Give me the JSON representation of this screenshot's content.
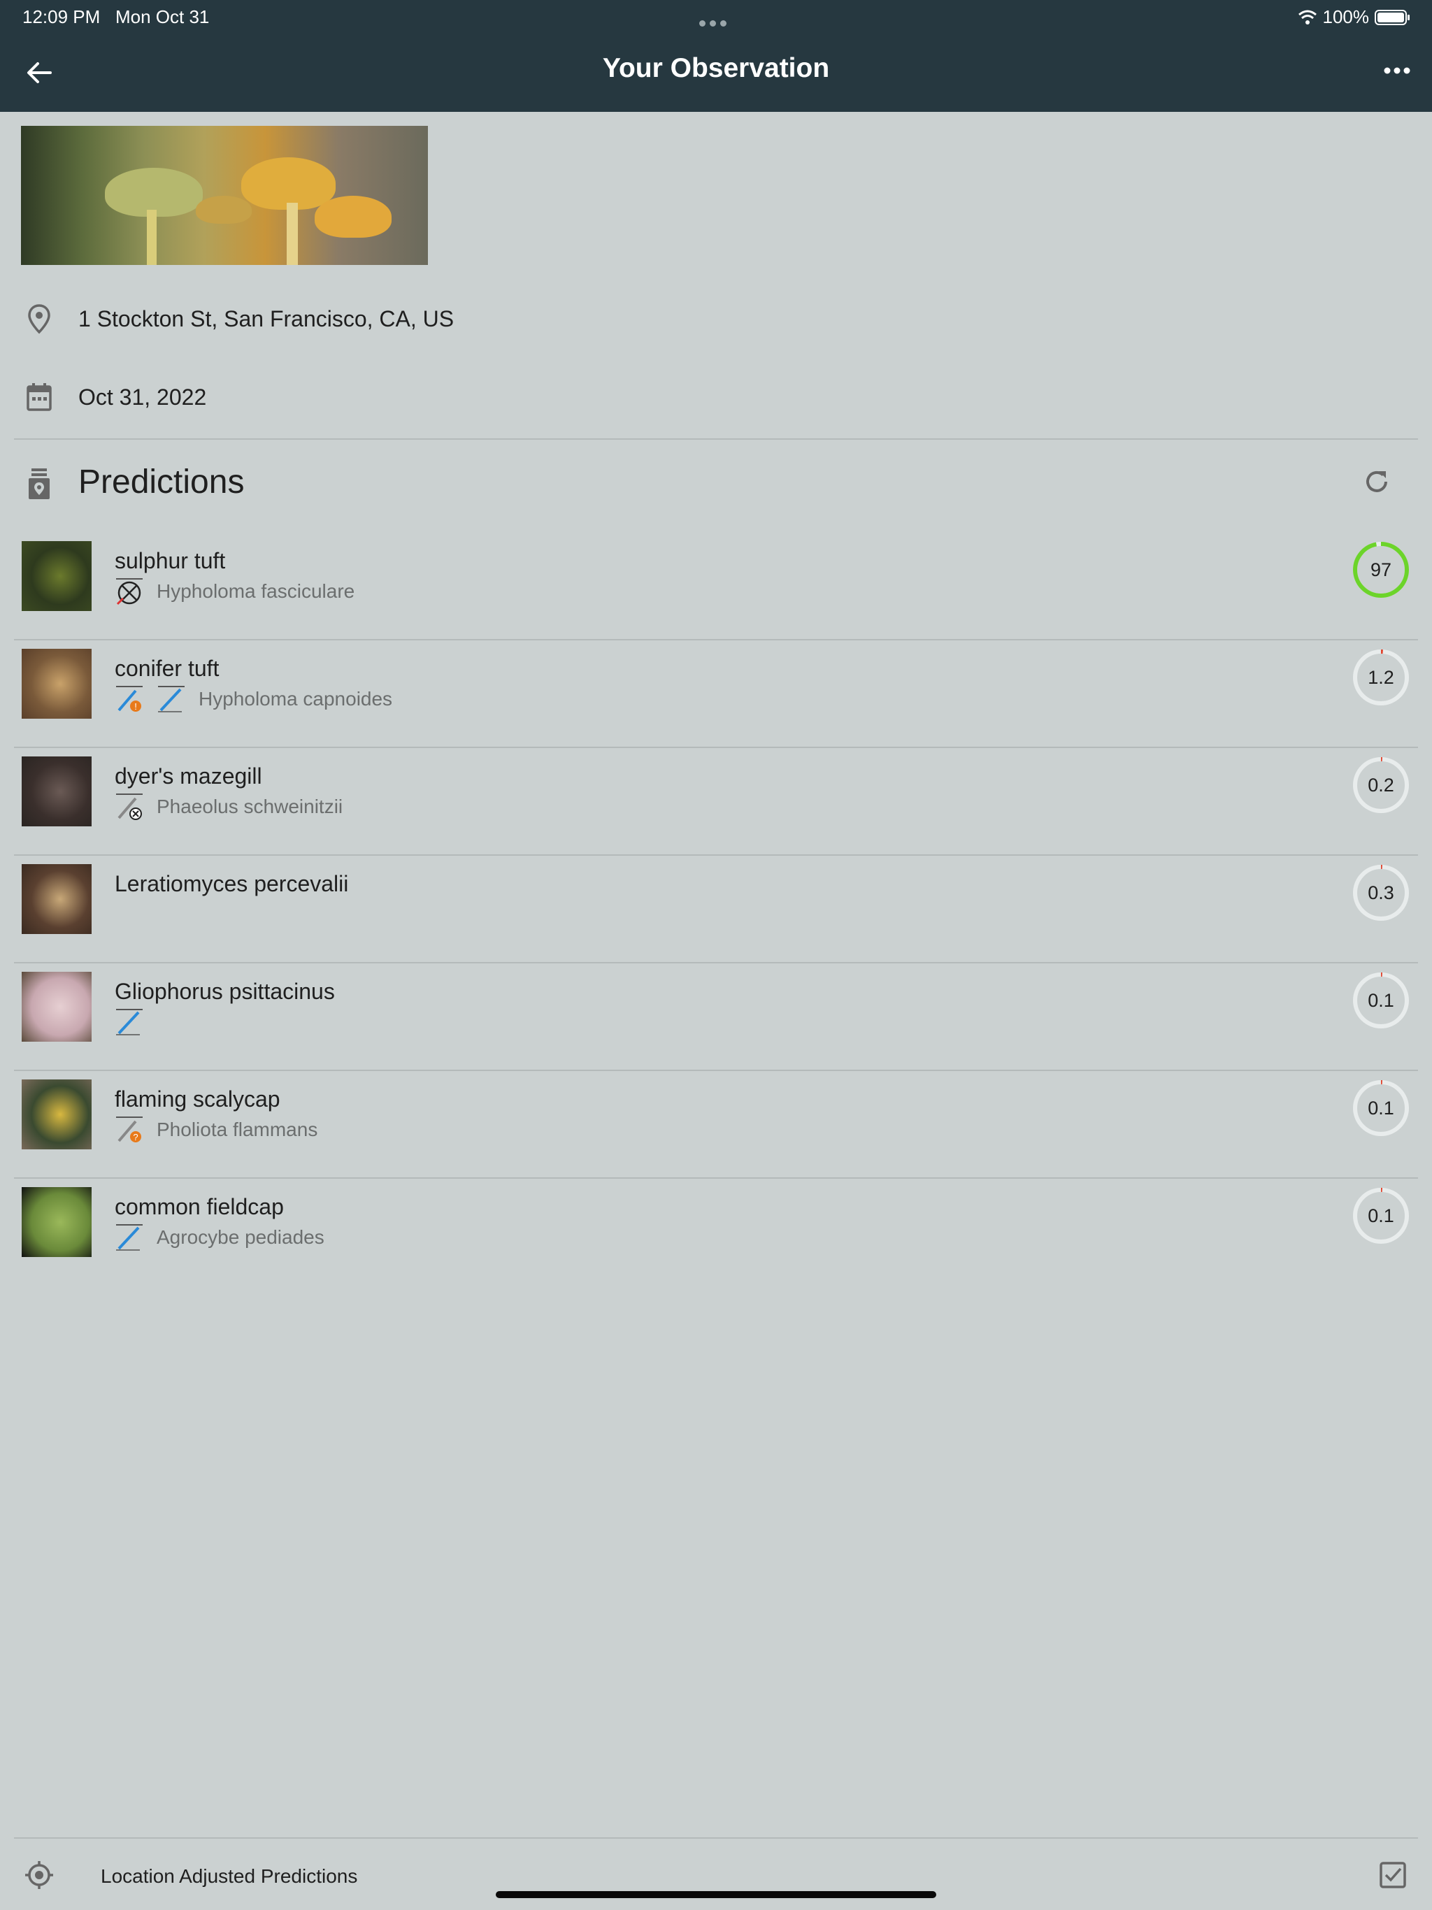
{
  "status_bar": {
    "time": "12:09 PM",
    "date": "Mon Oct 31",
    "battery": "100%"
  },
  "header": {
    "title": "Your Observation",
    "back_icon": "arrow-left-icon",
    "more_icon": "more-horizontal-icon",
    "background": "#263840"
  },
  "observation": {
    "location": "1 Stockton St, San Francisco, CA, US",
    "date": "Oct 31, 2022"
  },
  "predictions": {
    "title": "Predictions",
    "items": [
      {
        "name": "sulphur tuft",
        "scientific": "Hypholoma fasciculare",
        "badges": [
          "poison"
        ],
        "score": "97",
        "score_fraction": 0.97,
        "ring_color": "#6cd42a"
      },
      {
        "name": "conifer tuft",
        "scientific": "Hypholoma capnoides",
        "badges": [
          "edible-caution",
          "edible"
        ],
        "score": "1.2",
        "score_fraction": 0.012,
        "ring_color": "#e0442e"
      },
      {
        "name": "dyer's mazegill",
        "scientific": "Phaeolus schweinitzii",
        "badges": [
          "inedible"
        ],
        "score": "0.2",
        "score_fraction": 0.002,
        "ring_color": "#e0442e"
      },
      {
        "name": "Leratiomyces percevalii",
        "scientific": "",
        "badges": [],
        "score": "0.3",
        "score_fraction": 0.003,
        "ring_color": "#e0442e"
      },
      {
        "name": "Gliophorus psittacinus",
        "scientific": "",
        "badges": [
          "edible"
        ],
        "score": "0.1",
        "score_fraction": 0.001,
        "ring_color": "#e0442e"
      },
      {
        "name": "flaming scalycap",
        "scientific": "Pholiota flammans",
        "badges": [
          "unknown"
        ],
        "score": "0.1",
        "score_fraction": 0.001,
        "ring_color": "#e0442e"
      },
      {
        "name": "common fieldcap",
        "scientific": "Agrocybe pediades",
        "badges": [
          "edible"
        ],
        "score": "0.1",
        "score_fraction": 0.001,
        "ring_color": "#e0442e"
      }
    ]
  },
  "footer": {
    "label": "Location Adjusted Predictions",
    "checked": true
  }
}
